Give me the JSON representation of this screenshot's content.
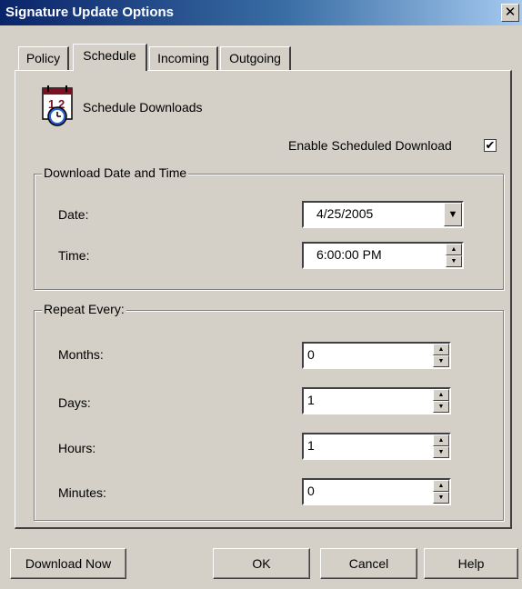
{
  "window": {
    "title": "Signature Update Options",
    "close_label": "✕"
  },
  "tabs": [
    "Policy",
    "Schedule",
    "Incoming",
    "Outgoing"
  ],
  "active_tab": "Schedule",
  "schedule": {
    "heading": "Schedule Downloads",
    "icon": "calendar-clock-icon",
    "enable_label": "Enable Scheduled Download",
    "enable_checked": true,
    "enable_check_glyph": "✔"
  },
  "download_group": {
    "legend": "Download Date and Time",
    "date_label": "Date:",
    "date_value": "4/25/2005",
    "time_label": "Time:",
    "time_value": "6:00:00 PM"
  },
  "repeat_group": {
    "legend": "Repeat Every:",
    "months_label": "Months:",
    "months_value": "0",
    "days_label": "Days:",
    "days_value": "1",
    "hours_label": "Hours:",
    "hours_value": "1",
    "minutes_label": "Minutes:",
    "minutes_value": "0"
  },
  "buttons": {
    "download_now": "Download Now",
    "ok": "OK",
    "cancel": "Cancel",
    "help": "Help"
  }
}
